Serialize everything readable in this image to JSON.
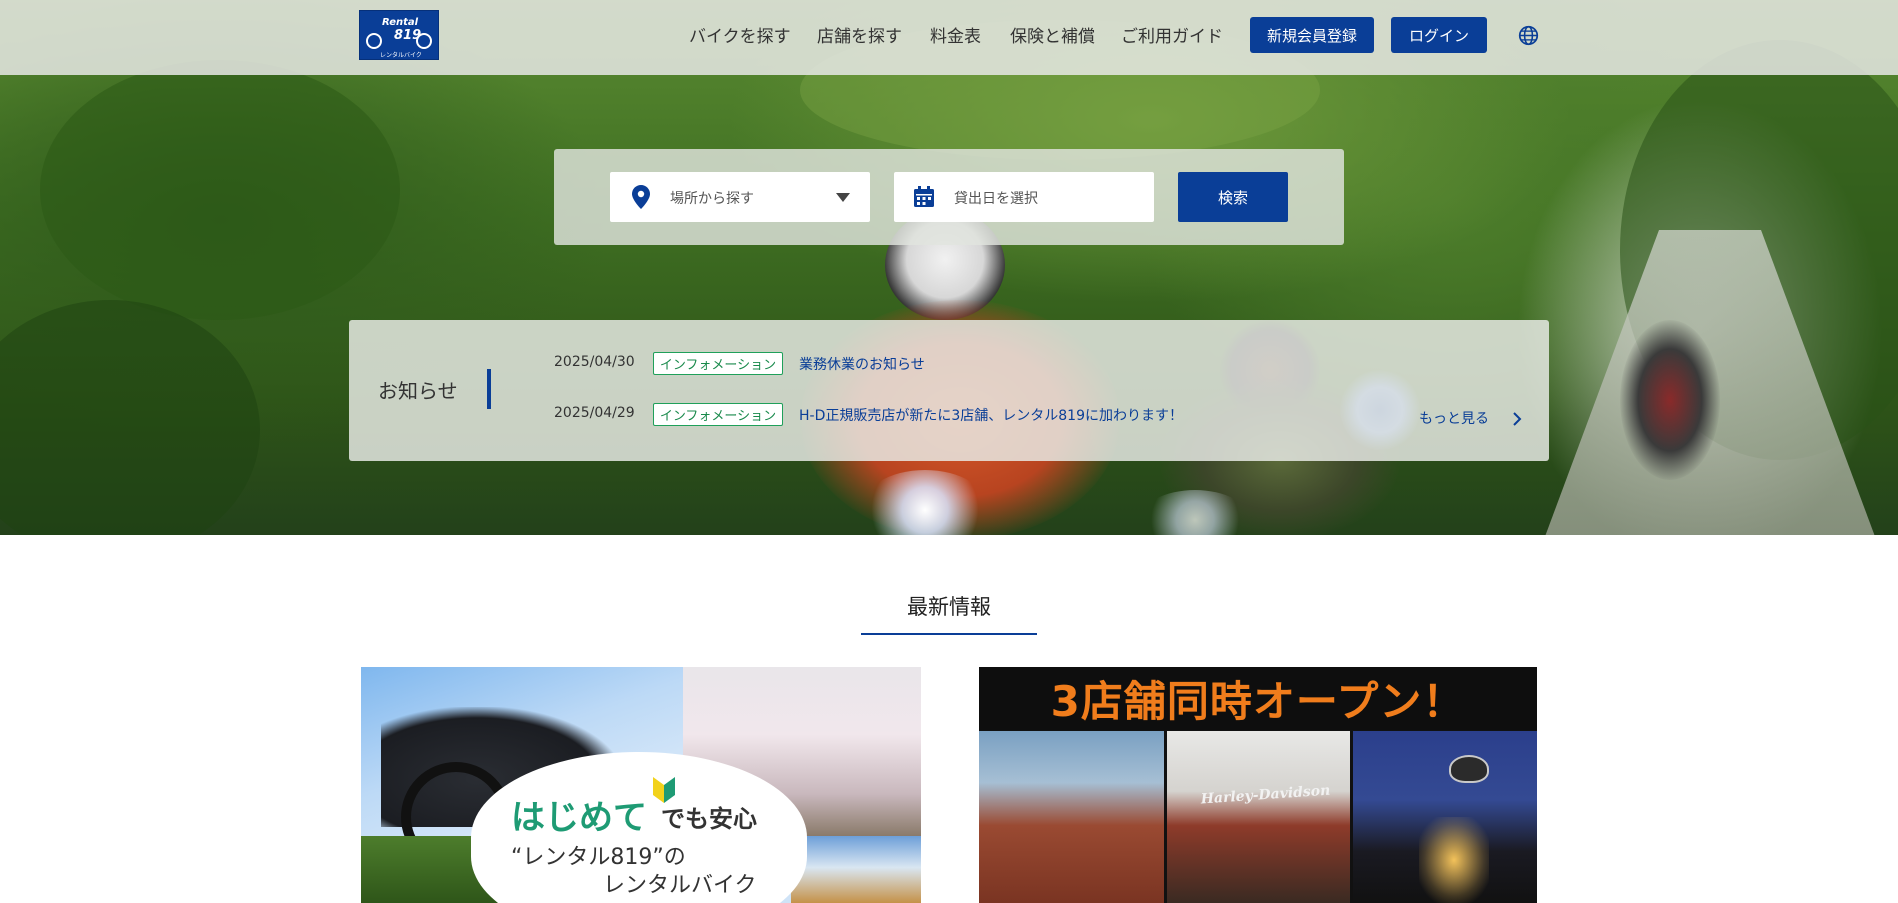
{
  "header": {
    "logo": {
      "line1": "Rental",
      "line2": "819",
      "line3": "レンタルバイク"
    },
    "nav": [
      {
        "label": "バイクを探す"
      },
      {
        "label": "店舗を探す"
      },
      {
        "label": "料金表"
      },
      {
        "label": "保険と補償"
      },
      {
        "label": "ご利用ガイド"
      }
    ],
    "register_label": "新規会員登録",
    "login_label": "ログイン",
    "language_icon": "globe-icon"
  },
  "search": {
    "location_placeholder": "場所から探す",
    "date_placeholder": "貸出日を選択",
    "button_label": "検索"
  },
  "news": {
    "title": "お知らせ",
    "items": [
      {
        "date": "2025/04/30",
        "tag": "インフォメーション",
        "text": "業務休業のお知らせ"
      },
      {
        "date": "2025/04/29",
        "tag": "インフォメーション",
        "text": "H-D正規販売店が新たに3店舗、レンタル819に加わります！"
      }
    ],
    "more_label": "もっと見る"
  },
  "latest": {
    "title": "最新情報",
    "card1": {
      "line1a": "はじめて",
      "line1b": "でも安心",
      "line2": "“レンタル819”の",
      "line3": "レンタルバイク"
    },
    "card2": {
      "headline": "3店舗同時オープン！",
      "sign": "Harley-Davidson"
    }
  },
  "colors": {
    "brand_blue": "#0a3e97",
    "tag_green": "#1fa05a",
    "promo_orange": "#f07d1c"
  }
}
